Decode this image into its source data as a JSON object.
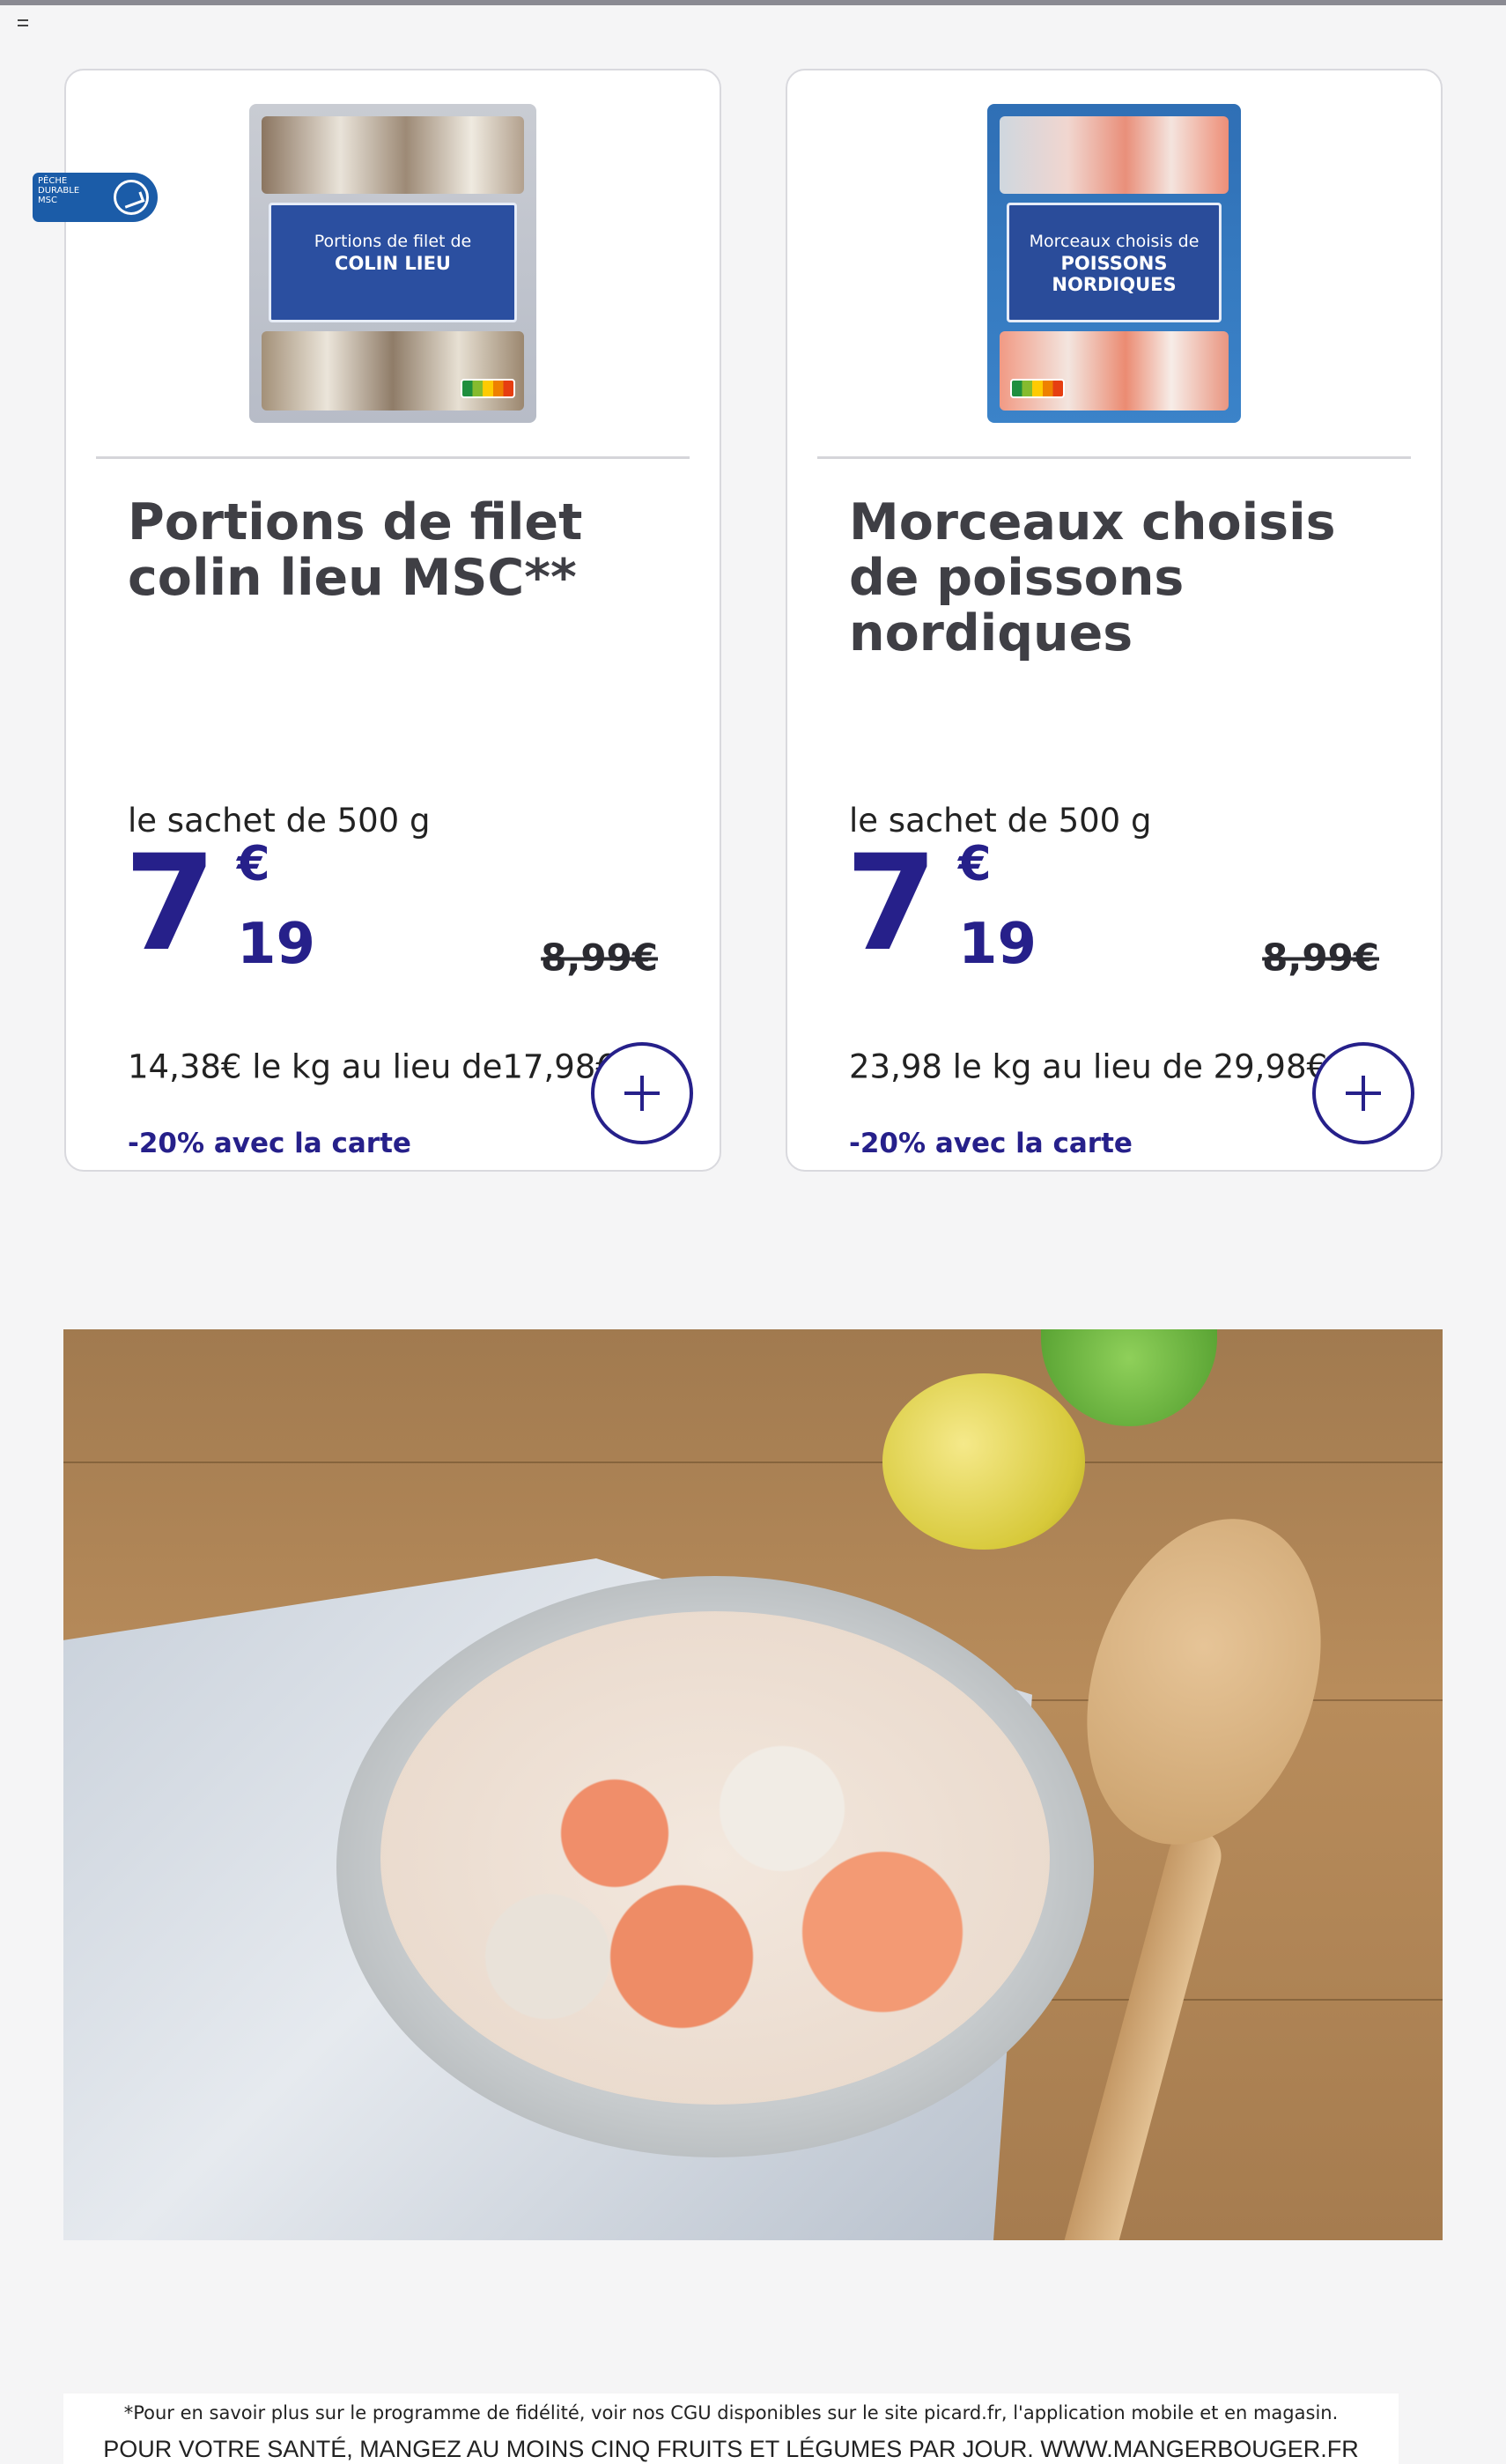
{
  "products": [
    {
      "title": "Portions de filet colin lieu MSC**",
      "pack_label_line1": "Portions de filet de",
      "pack_label_line2": "COLIN LIEU",
      "unit": "le sachet de 500 g",
      "price_int": "7",
      "price_currency": "€",
      "price_cents": "19",
      "old_price": "8,99€",
      "per_kg": "14,38€ le kg au lieu de17,98€",
      "discount": "-20% avec la carte"
    },
    {
      "title": "Morceaux choisis de poissons nordiques",
      "pack_label_line1": "Morceaux choisis de",
      "pack_label_line2": "POISSONS NORDIQUES",
      "unit": "le sachet de 500 g",
      "price_int": "7",
      "price_currency": "€",
      "price_cents": "19",
      "old_price": "8,99€",
      "per_kg": "23,98 le kg au lieu de 29,98€",
      "discount": "-20% avec la carte"
    }
  ],
  "msc_badge": {
    "text": "PÊCHE DURABLE MSC"
  },
  "footer": {
    "footnote": "*Pour en savoir plus sur le programme de fidélité, voir nos CGU disponibles sur le site picard.fr, l'application mobile et en magasin.",
    "health": "POUR VOTRE SANTÉ, MANGEZ AU MOINS CINQ FRUITS ET LÉGUMES PAR JOUR. WWW.MANGERBOUGER.FR"
  },
  "icons": [
    "menu-icon",
    "plus-icon",
    "msc-logo-icon"
  ],
  "colors": {
    "accent": "#26208a",
    "msc_blue": "#1b5ca8"
  }
}
